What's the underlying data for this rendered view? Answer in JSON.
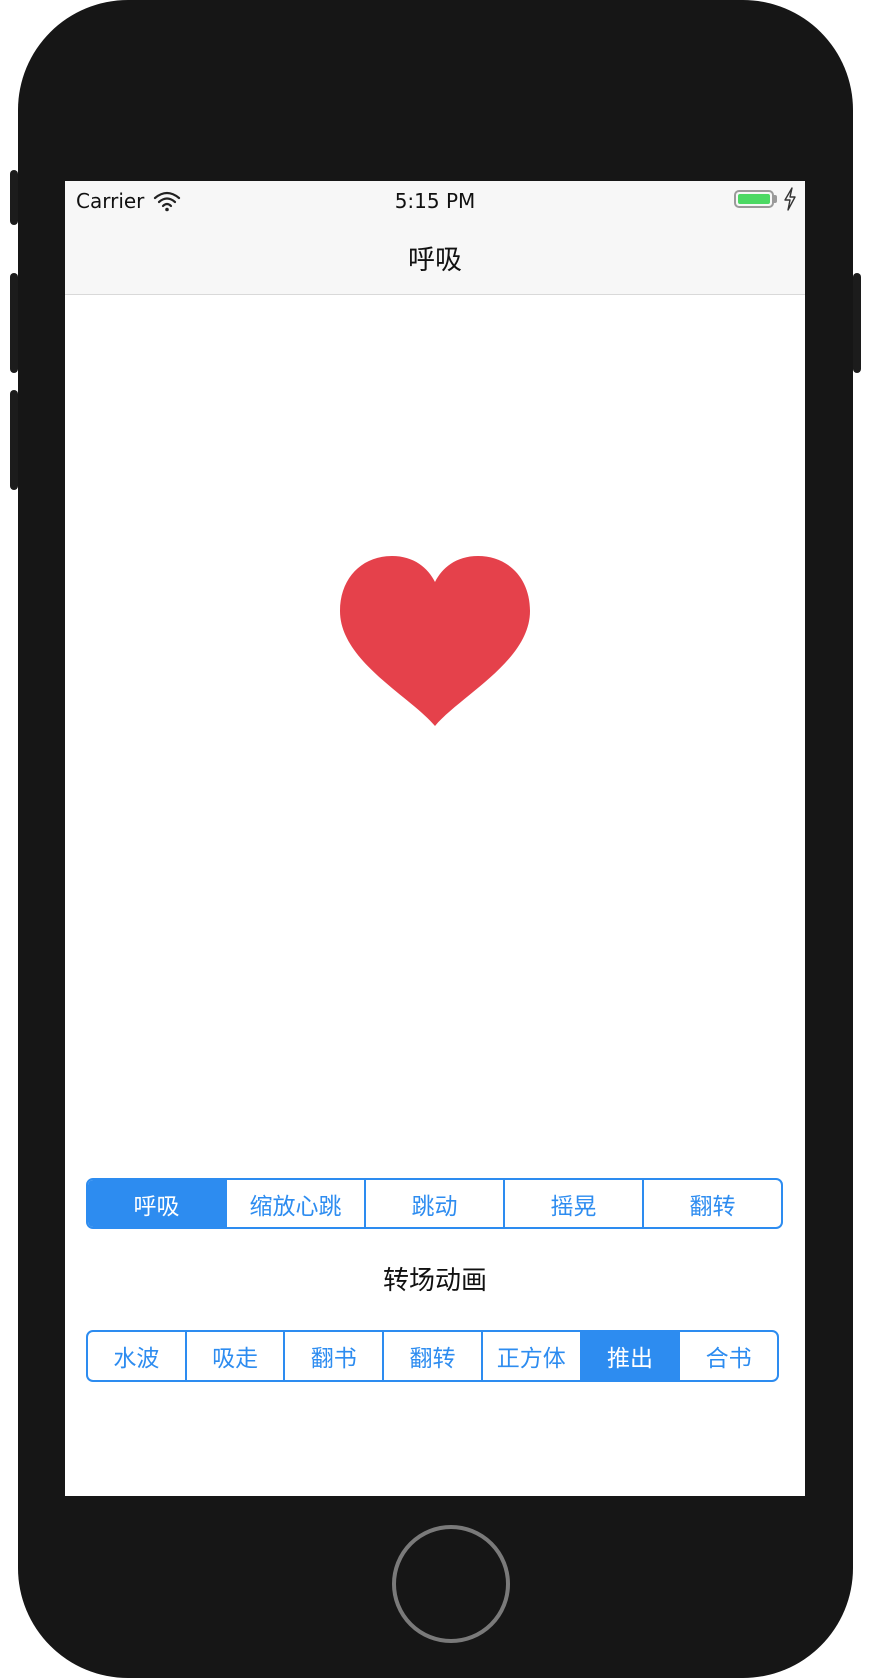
{
  "status_bar": {
    "carrier": "Carrier",
    "time": "5:15 PM",
    "icons": [
      "wifi-icon",
      "battery-icon",
      "charging-bolt-icon"
    ]
  },
  "nav": {
    "title": "呼吸"
  },
  "content": {
    "icon": "heart-icon",
    "heart_color": "#e5414b"
  },
  "animation_control": {
    "segments": [
      {
        "label": "呼吸",
        "selected": true
      },
      {
        "label": "缩放心跳",
        "selected": false
      },
      {
        "label": "跳动",
        "selected": false
      },
      {
        "label": "摇晃",
        "selected": false
      },
      {
        "label": "翻转",
        "selected": false
      }
    ]
  },
  "transition": {
    "section_label": "转场动画",
    "segments": [
      {
        "label": "水波",
        "selected": false
      },
      {
        "label": "吸走",
        "selected": false
      },
      {
        "label": "翻书",
        "selected": false
      },
      {
        "label": "翻转",
        "selected": false
      },
      {
        "label": "正方体",
        "selected": false
      },
      {
        "label": "推出",
        "selected": true
      },
      {
        "label": "合书",
        "selected": false
      }
    ]
  },
  "colors": {
    "accent": "#2d8cf0",
    "device_body": "#161616",
    "battery": "#4cd964"
  }
}
